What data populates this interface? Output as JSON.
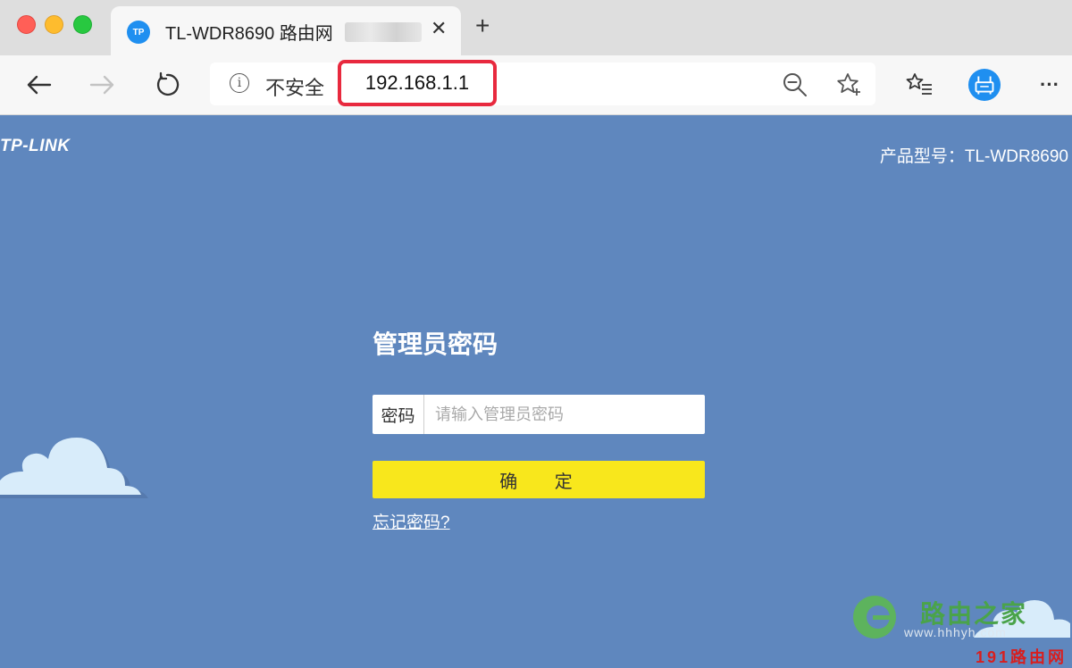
{
  "browser": {
    "tab": {
      "favicon": "TP",
      "title": "TL-WDR8690 路由网",
      "close": "✕"
    },
    "new_tab": "+",
    "address": {
      "security_label": "不安全",
      "url": "192.168.1.1"
    },
    "more": "···"
  },
  "page": {
    "brand": "TP-LINK",
    "model": "产品型号：TL-WDR8690",
    "login": {
      "title": "管理员密码",
      "password_label": "密码",
      "password_placeholder": "请输入管理员密码",
      "password_value": "",
      "confirm_button": "确 定",
      "forgot_link": "忘记密码?"
    }
  },
  "watermark": {
    "name": "路由之家",
    "url": "www.hhhyh.com",
    "site": "191路由网"
  },
  "colors": {
    "page_background": "#5f87be",
    "confirm_button": "#f8e71c",
    "url_highlight": "#e8293e",
    "avatar": "#1f8ff0"
  }
}
